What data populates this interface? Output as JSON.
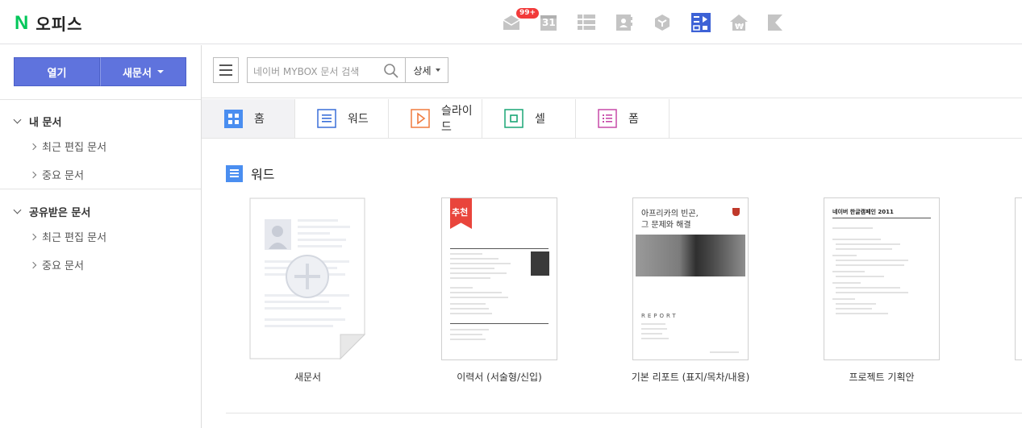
{
  "header": {
    "logo_mark": "N",
    "app_title": "오피스",
    "mail_badge": "99+",
    "calendar_number": "31",
    "apps": [
      "mail-icon",
      "calendar-icon",
      "contacts-list-icon",
      "contacts-book-icon",
      "cube-icon",
      "office-icon",
      "household-icon",
      "bookmark-icon"
    ],
    "active_app_color": "#3d62d6"
  },
  "sidebar": {
    "open_label": "열기",
    "new_label": "새문서",
    "groups": [
      {
        "label": "내 문서",
        "items": [
          {
            "label": "최근 편집 문서"
          },
          {
            "label": "중요 문서"
          }
        ]
      },
      {
        "label": "공유받은 문서",
        "items": [
          {
            "label": "최근 편집 문서"
          },
          {
            "label": "중요 문서"
          }
        ]
      }
    ]
  },
  "search": {
    "placeholder": "네이버 MYBOX 문서 검색",
    "detail_label": "상세"
  },
  "tabs": [
    {
      "label": "홈",
      "icon": "home-grid-icon",
      "color": "#4a8ef0"
    },
    {
      "label": "워드",
      "icon": "word-icon",
      "color": "#3a6fd8"
    },
    {
      "label": "슬라이드",
      "icon": "slide-icon",
      "color": "#f07b3f"
    },
    {
      "label": "셀",
      "icon": "cell-icon",
      "color": "#1aa676"
    },
    {
      "label": "폼",
      "icon": "form-icon",
      "color": "#c74aa9"
    }
  ],
  "section": {
    "title": "워드",
    "templates": [
      {
        "label": "새문서"
      },
      {
        "label": "이력서 (서술형/신입)",
        "ribbon": "추천"
      },
      {
        "label": "기본 리포트 (표지/목차/내용)",
        "heading_line1": "아프리카의 빈곤,",
        "heading_line2": "그 문제와 해결",
        "report_word": "REPORT"
      },
      {
        "label": "프로젝트 기획안",
        "heading": "네이버 한글캠페인 2011"
      }
    ]
  }
}
